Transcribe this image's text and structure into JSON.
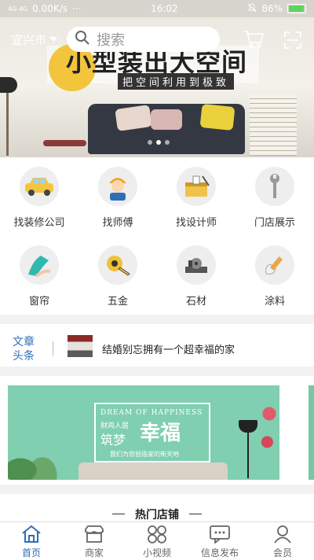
{
  "status_bar": {
    "network": "4G 4G",
    "speed": "0.00K/s",
    "more": "···",
    "time": "16:02",
    "battery": "86%",
    "battery_color": "#5fd35f"
  },
  "header": {
    "city": "宜兴市",
    "search_placeholder": "搜索",
    "icons": [
      "cart-icon",
      "scan-icon"
    ]
  },
  "hero": {
    "title": "小型装出大空间",
    "subtitle": "把空间利用到极致",
    "carousel_pages": 3,
    "carousel_active_index": 1
  },
  "categories": [
    {
      "label": "找装修公司",
      "icon": "taxi-car-icon"
    },
    {
      "label": "找师傅",
      "icon": "worker-icon"
    },
    {
      "label": "找设计师",
      "icon": "designer-toolbox-icon"
    },
    {
      "label": "门店展示",
      "icon": "store-wrench-icon"
    },
    {
      "label": "窗帘",
      "icon": "curtain-icon"
    },
    {
      "label": "五金",
      "icon": "tape-measure-icon"
    },
    {
      "label": "石材",
      "icon": "stone-cutter-icon"
    },
    {
      "label": "涂料",
      "icon": "paint-brush-icon"
    }
  ],
  "articles": {
    "tag_line1": "文章",
    "tag_line2": "头条",
    "headline": "结婚别忘拥有一个超幸福的家"
  },
  "promo_banner": {
    "english": "DREAM OF HAPPINESS",
    "brand": "筑梦",
    "big_text": "幸福",
    "small_text": "财鸡人居",
    "tagline": "我们为您创造家的新天地",
    "bg_color": "#7fcfb0"
  },
  "hot_shops": {
    "title": "热门店铺"
  },
  "bottom_nav": [
    {
      "label": "首页",
      "icon": "home-icon",
      "active": true
    },
    {
      "label": "商家",
      "icon": "shop-icon",
      "active": false
    },
    {
      "label": "小视频",
      "icon": "video-grid-icon",
      "active": false
    },
    {
      "label": "信息发布",
      "icon": "message-icon",
      "active": false
    },
    {
      "label": "会员",
      "icon": "user-icon",
      "active": false
    }
  ],
  "accent_color": "#2e6fb7"
}
